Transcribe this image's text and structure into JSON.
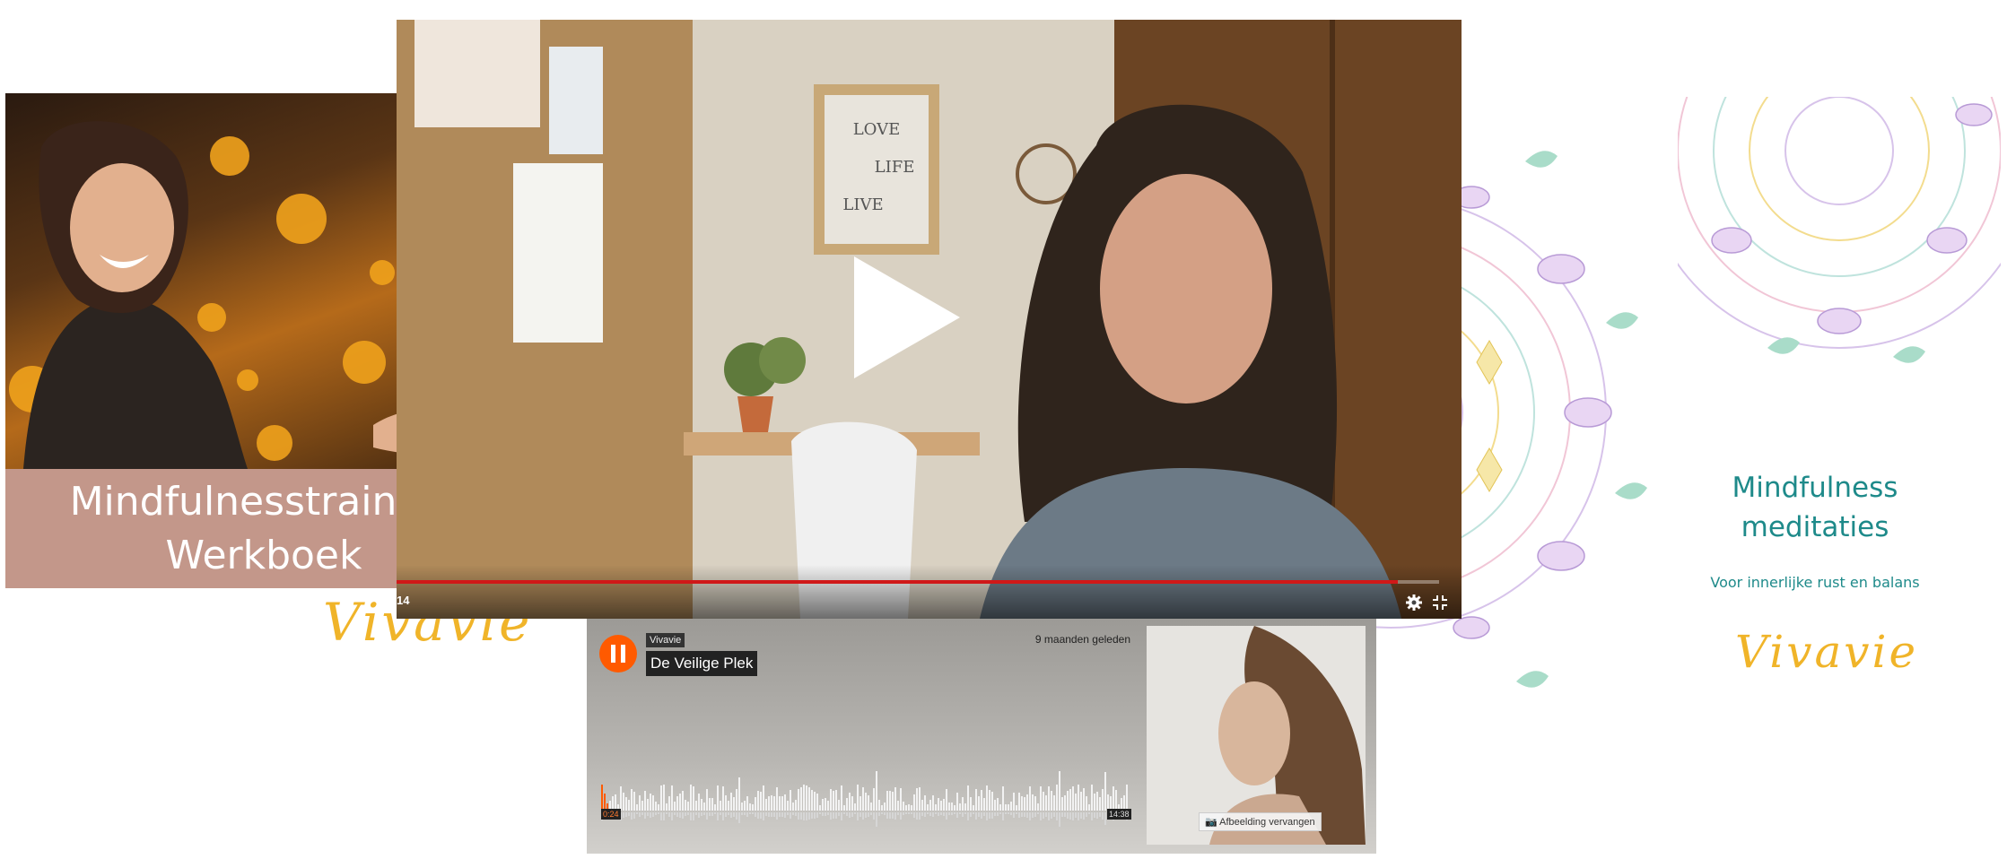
{
  "workbook": {
    "title_line1": "Mindfulnesstraining",
    "title_line2": "Werkboek",
    "brand": "Vivavie",
    "band_color": "#c3978a"
  },
  "video": {
    "time_display": "14",
    "progress": 0.96,
    "accent": "#d01818",
    "poster": {
      "line1": "LOVE",
      "line2": "LIFE",
      "line3": "LIVE"
    },
    "icons": [
      "play-icon",
      "gear-icon",
      "exit-fullscreen-icon"
    ]
  },
  "audio": {
    "user": "Vivavie",
    "title": "De Veilige Plek",
    "date": "9 maanden geleden",
    "time_elapsed": "0:24",
    "time_total": "14:38",
    "replace_image": "Afbeelding vervangen",
    "accent": "#ff5a00"
  },
  "meditaties": {
    "title_line1": "Mindfulness",
    "title_line2": "meditaties",
    "subtitle": "Voor innerlijke rust en balans",
    "brand": "Vivavie",
    "title_color": "#1e8a8a"
  }
}
